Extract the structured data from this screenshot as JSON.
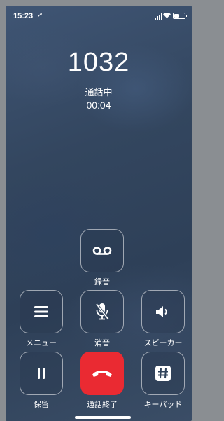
{
  "status": {
    "time": "15:23"
  },
  "call": {
    "caller": "1032",
    "state": "通話中",
    "duration": "00:04"
  },
  "controls": {
    "record": "録音",
    "menu": "メニュー",
    "mute": "消音",
    "speaker": "スピーカー",
    "hold": "保留",
    "end": "通話終了",
    "keypad": "キーパッド"
  },
  "colors": {
    "end_call": "#ea2a32"
  }
}
